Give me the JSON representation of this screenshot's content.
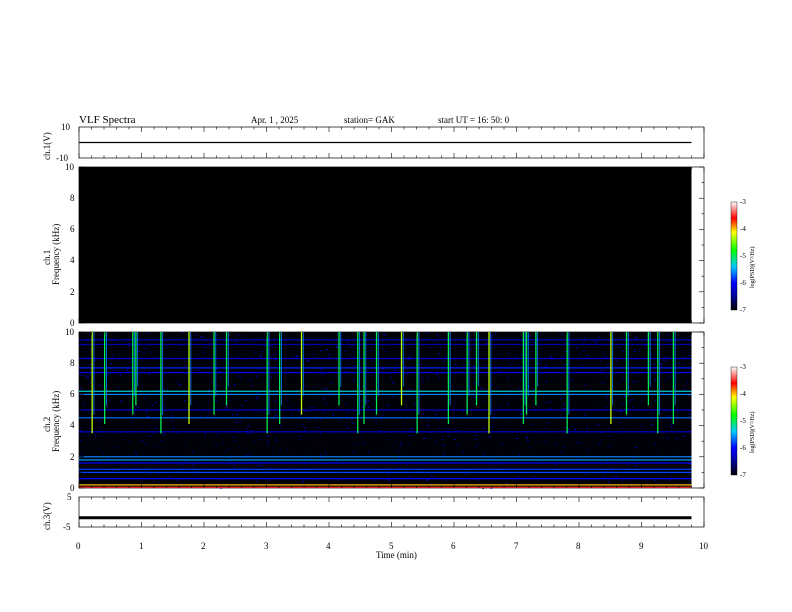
{
  "header": {
    "title": "VLF Spectra",
    "date": "Apr. 1 , 2025",
    "station": "station= GAK",
    "start_ut": "start UT = 16: 50: 0"
  },
  "panels": {
    "ch1_wave": {
      "ylabel": "ch.1(V)",
      "ticks": [
        "10",
        "-10"
      ]
    },
    "ch1_spec": {
      "ylabel_a": "ch.1",
      "ylabel_b": "Frequency (kHz)",
      "ticks": [
        "10",
        "8",
        "6",
        "4",
        "2",
        "0"
      ]
    },
    "ch2_spec": {
      "ylabel_a": "ch.2",
      "ylabel_b": "Frequency (kHz)",
      "ticks": [
        "10",
        "8",
        "6",
        "4",
        "2",
        "0"
      ]
    },
    "ch3_wave": {
      "ylabel": "ch.3(V)",
      "ticks": [
        "5",
        "-5"
      ]
    }
  },
  "xaxis": {
    "label": "Time (min)",
    "ticks": [
      "0",
      "1",
      "2",
      "3",
      "4",
      "5",
      "6",
      "7",
      "8",
      "9",
      "10"
    ]
  },
  "colorbar": {
    "label": "log(PSD)(V²/Hz)",
    "ticks": [
      "-3",
      "-4",
      "-5",
      "-6",
      "-7"
    ]
  },
  "chart_data": [
    {
      "type": "line",
      "panel": "ch1_wave",
      "ylabel": "ch.1(V)",
      "x_unit": "min",
      "xlim": [
        0,
        10
      ],
      "ylim": [
        -10,
        10
      ],
      "x": [
        0,
        9.8
      ],
      "values": [
        0,
        0
      ]
    },
    {
      "type": "heatmap",
      "panel": "ch1_spec",
      "ylabel": "Frequency (kHz)",
      "xlim": [
        0,
        10
      ],
      "ylim": [
        0,
        10
      ],
      "data_extent_min": [
        0,
        9.8
      ],
      "fill_log_psd": -7,
      "colorscale": [
        "#000000",
        "#0000ff",
        "#00c8ff",
        "#00ff00",
        "#ffff00",
        "#ff0000",
        "#ffffff"
      ],
      "zlim": [
        -7,
        -3
      ]
    },
    {
      "type": "heatmap",
      "panel": "ch2_spec",
      "ylabel": "Frequency (kHz)",
      "xlim": [
        0,
        10
      ],
      "ylim": [
        0,
        10
      ],
      "data_extent_min": [
        0,
        9.8
      ],
      "zlim": [
        -7,
        -3
      ],
      "horizontal_bands_khz": [
        {
          "freq": 9.5,
          "log_psd": -6.3
        },
        {
          "freq": 9.2,
          "log_psd": -6.4
        },
        {
          "freq": 8.3,
          "log_psd": -6.2
        },
        {
          "freq": 7.7,
          "log_psd": -5.9
        },
        {
          "freq": 7.4,
          "log_psd": -6.1
        },
        {
          "freq": 6.2,
          "log_psd": -5.3
        },
        {
          "freq": 6.0,
          "log_psd": -5.6
        },
        {
          "freq": 5.0,
          "log_psd": -6.2
        },
        {
          "freq": 4.5,
          "log_psd": -5.7
        },
        {
          "freq": 3.6,
          "log_psd": -6.2
        },
        {
          "freq": 2.0,
          "log_psd": -5.6
        },
        {
          "freq": 1.8,
          "log_psd": -5.5
        },
        {
          "freq": 1.6,
          "log_psd": -6.0
        },
        {
          "freq": 1.2,
          "log_psd": -5.8
        },
        {
          "freq": 1.0,
          "log_psd": -5.8
        },
        {
          "freq": 0.6,
          "log_psd": -6.0
        },
        {
          "freq": 0.2,
          "log_psd": -4.0
        },
        {
          "freq": 0.05,
          "log_psd": -3.5
        }
      ],
      "impulsive_bursts_min": [
        0.2,
        0.4,
        0.85,
        0.9,
        1.3,
        1.75,
        2.15,
        2.35,
        3.0,
        3.2,
        3.55,
        4.15,
        4.45,
        4.55,
        4.75,
        5.15,
        5.4,
        5.9,
        6.2,
        6.35,
        6.55,
        7.1,
        7.15,
        7.3,
        7.8,
        8.5,
        8.75,
        9.1,
        9.25,
        9.5
      ]
    },
    {
      "type": "line",
      "panel": "ch3_wave",
      "ylabel": "ch.3(V)",
      "x_unit": "min",
      "xlim": [
        0,
        10
      ],
      "ylim": [
        -5,
        5
      ],
      "x": [
        0,
        9.8
      ],
      "values": [
        -1.9,
        -1.9
      ]
    }
  ]
}
